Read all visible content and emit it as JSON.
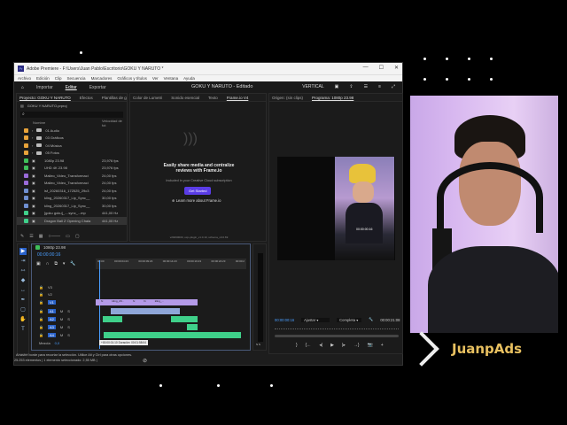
{
  "window": {
    "title": "Adobe Premiere - F:\\Users\\Juan Pablo\\Escritorio\\GOKU Y NARUTO *",
    "app_icon": "Pr",
    "controls": [
      "—",
      "☐",
      "✕"
    ]
  },
  "menu": [
    "Archivo",
    "Edición",
    "Clip",
    "Secuencia",
    "Marcadores",
    "Gráficos y títulos",
    "Ver",
    "Ventana",
    "Ayuda"
  ],
  "header": {
    "nav": [
      "Importar",
      "Editar",
      "Exportar"
    ],
    "active": "Editar",
    "title": "GOKU Y NARUTO - Editado",
    "workspace": "VERTICAL"
  },
  "project": {
    "tabs": [
      "Proyecto: GOKU Y NARUTO",
      "Efectos",
      "Plantillas de g"
    ],
    "bin": "GOKU Y NARUTO.prproj",
    "col_name": "Nombre",
    "col_fps": "Velocidad de fot",
    "items": [
      {
        "name": "01 Audio",
        "fps": "",
        "color": "#e8a33a",
        "folder": true
      },
      {
        "name": "03 Gráficos",
        "fps": "",
        "color": "#e8a33a",
        "folder": true
      },
      {
        "name": "04 Música",
        "fps": "",
        "color": "#e8a33a",
        "folder": true
      },
      {
        "name": "05 Fotos",
        "fps": "",
        "color": "#e8a33a",
        "folder": true
      },
      {
        "name": "1080p 23.98",
        "fps": "23,976 fps",
        "color": "#3fbf5a"
      },
      {
        "name": "UHD 4K 23.98",
        "fps": "23,976 fps",
        "color": "#3fbf5a"
      },
      {
        "name": "Malleo_Video_Transformaci",
        "fps": "24,00 fps",
        "color": "#9a6bd8"
      },
      {
        "name": "Malleo_Video_Transformaci",
        "fps": "24,00 fps",
        "color": "#9a6bd8"
      },
      {
        "name": "lsf_20260316_172525_29c3",
        "fps": "24,00 fps",
        "color": "#6f8fd0"
      },
      {
        "name": "kling_20260317_Lip_Sync__",
        "fps": "30,00 fps",
        "color": "#6f8fd0"
      },
      {
        "name": "kling_20260317_Lip_Sync__",
        "fps": "30,00 fps",
        "color": "#6f8fd0"
      },
      {
        "name": "[goku goku]_....sync_...mp",
        "fps": "441,00 Hz",
        "color": "#3fd08a"
      },
      {
        "name": "Dragon Ball Z Opening Chala",
        "fps": "441,00 Hz",
        "color": "#3fd08a"
      }
    ]
  },
  "frameio": {
    "tabs": [
      "Color de Lumetri",
      "Sonido esencial",
      "Texto",
      "Frame.io V4"
    ],
    "headline": "Easily share media and centralize reviews with Frame.io",
    "sub": "Included in your Creative Cloud subscription",
    "cta": "Get Started",
    "link": "Learn more about Frame.io",
    "version": "v20260000, uxp-plugin_v1.0.10, schema_v0.0.69"
  },
  "program": {
    "tabs": [
      "Origen: (sin clips)",
      "Programa: 1080p 23.98"
    ],
    "timecode": "00:00:00:16",
    "fit": "Ajustar",
    "quality": "Completa",
    "duration": "00:00:21:08",
    "overlay_caption": "00:00:00:16"
  },
  "timeline": {
    "sequence": "1080p 23.98",
    "timecode": "00:00:00:16",
    "ruler": [
      "00:00",
      "00:00:04:23",
      "00:00:09:23",
      "00:00:14:23",
      "00:00:19:23",
      "00:00:24:23",
      "00:00:2"
    ],
    "video_tracks": [
      "V3",
      "V2",
      "V1"
    ],
    "audio_tracks": [
      "A1",
      "A2",
      "A3",
      "A4"
    ],
    "mix": "Mezcla",
    "mix_value": "0,0",
    "clips": [
      "fx",
      "kling_20...",
      "fx",
      "fx",
      "kling_..."
    ],
    "tooltip": "+00:00:01:10 Duración: 00:01:58:04",
    "meter_value": "S S"
  },
  "status": {
    "hint": "Arrastre borde para recortar la selección. Utilice Alt y Ctrl para otras opciones.",
    "info": "25.253 elementos | 1 elemento seleccionado: 2,55 MB |"
  },
  "overlay": {
    "brand": "JuanpAds",
    "brand_color": "#e8c060"
  }
}
